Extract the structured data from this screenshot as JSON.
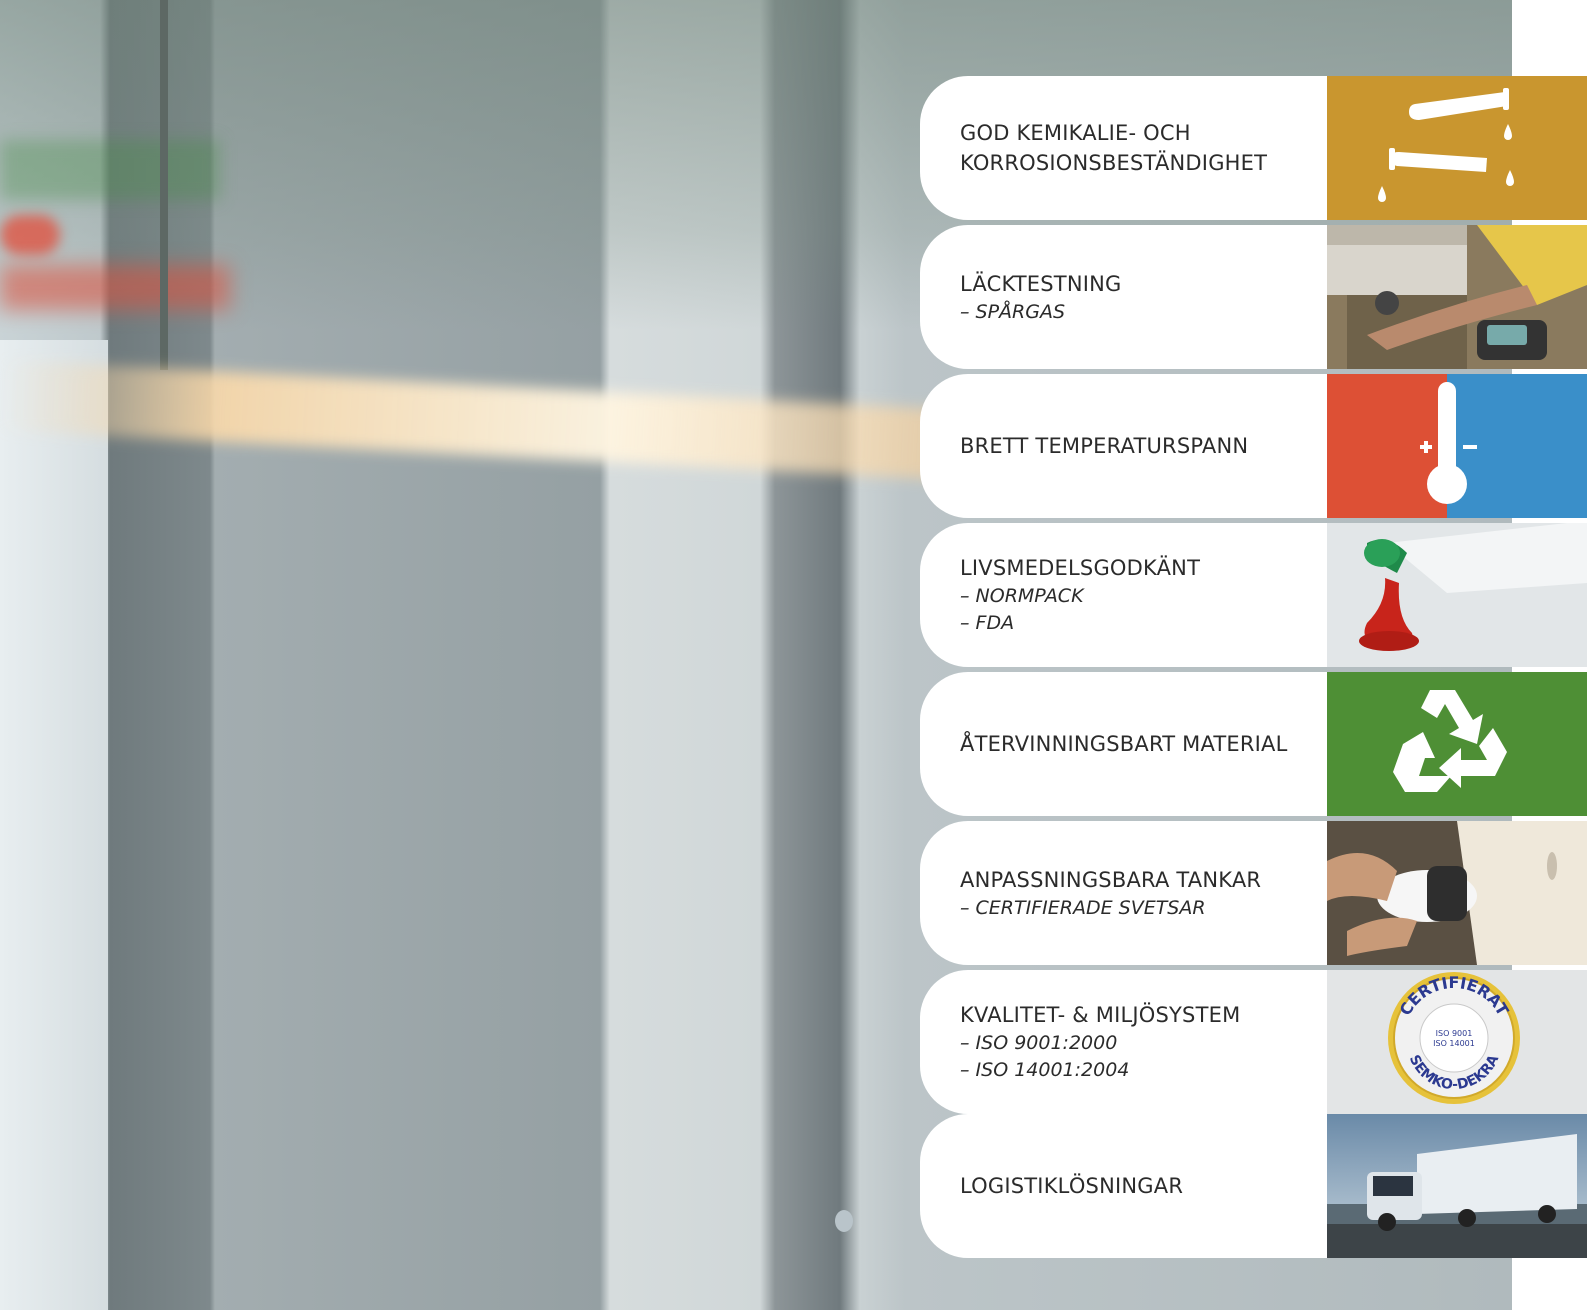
{
  "features": [
    {
      "title_lines": [
        "GOD KEMIKALIE- OCH",
        "KORROSIONSBESTÄNDIGHET"
      ],
      "subs": [],
      "icon": "chemical-icon",
      "color": "#c9962f"
    },
    {
      "title_lines": [
        "LÄCKTESTNING"
      ],
      "subs": [
        "– SPÅRGAS"
      ],
      "icon": "leak-testing-photo"
    },
    {
      "title_lines": [
        "BRETT TEMPERATURSPANN"
      ],
      "subs": [],
      "icon": "thermometer-icon",
      "colors": [
        "#dd5035",
        "#3a8fc9"
      ],
      "plus": "+",
      "minus": "–"
    },
    {
      "title_lines": [
        "LIVSMEDELSGODKÄNT"
      ],
      "subs": [
        "– NORMPACK",
        "– FDA"
      ],
      "icon": "ketchup-photo"
    },
    {
      "title_lines": [
        "ÅTERVINNINGSBART MATERIAL"
      ],
      "subs": [],
      "icon": "recycle-icon",
      "color": "#4e8f35"
    },
    {
      "title_lines": [
        "ANPASSNINGSBARA TANKAR"
      ],
      "subs": [
        "– CERTIFIERADE SVETSAR"
      ],
      "icon": "welding-photo"
    },
    {
      "title_lines": [
        "KVALITET- & MILJÖSYSTEM"
      ],
      "subs": [
        "– ISO 9001:2000",
        "– ISO 14001:2004"
      ],
      "icon": "certified-seal-icon",
      "seal": {
        "top": "CERTIFIERAT",
        "middle1": "ISO 9001",
        "middle2": "ISO 14001",
        "bottom": "SEMKO-DEKRA"
      }
    },
    {
      "title_lines": [
        "LOGISTIKLÖSNINGAR"
      ],
      "subs": [],
      "icon": "truck-photo"
    }
  ]
}
